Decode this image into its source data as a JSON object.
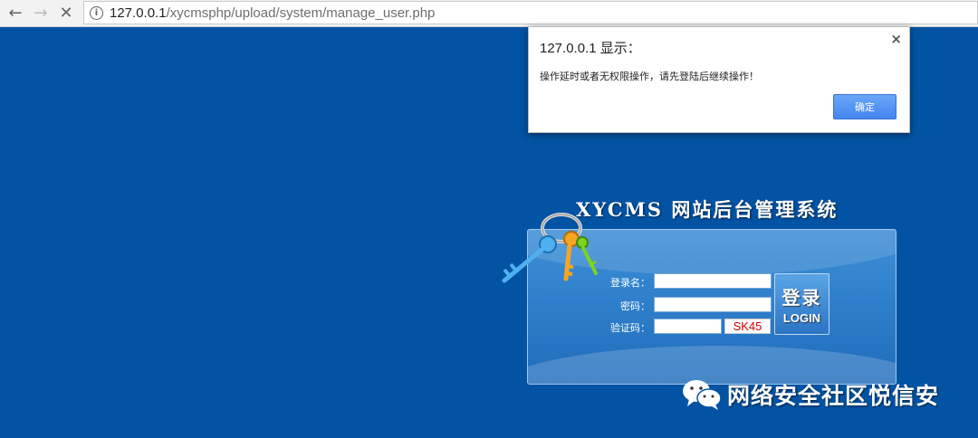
{
  "browser": {
    "url_host": "127.0.0.1",
    "url_path": "/xycmsphp/upload/system/manage_user.php",
    "back_icon": "back-arrow-icon",
    "forward_icon": "forward-arrow-icon",
    "stop_icon": "close-icon",
    "info_icon": "info-icon"
  },
  "alert": {
    "title": "127.0.0.1 显示：",
    "message": "操作延时或者无权限操作，请先登陆后继续操作！",
    "ok_label": "确定",
    "close_label": "×"
  },
  "login": {
    "title": "XYCMS 网站后台管理系统",
    "username_label": "登录名：",
    "password_label": "密码：",
    "captcha_label": "验证码：",
    "username_value": "",
    "password_value": "",
    "captcha_input_value": "",
    "captcha_code": "SK45",
    "button_label_cn": "登录",
    "button_label_en": "LOGIN"
  },
  "watermark": {
    "text": "网络安全社区悦信安",
    "icon": "wechat-icon"
  },
  "colors": {
    "background": "#0353a4",
    "alert_button": "#4485f0",
    "captcha_text": "#cc0000"
  }
}
